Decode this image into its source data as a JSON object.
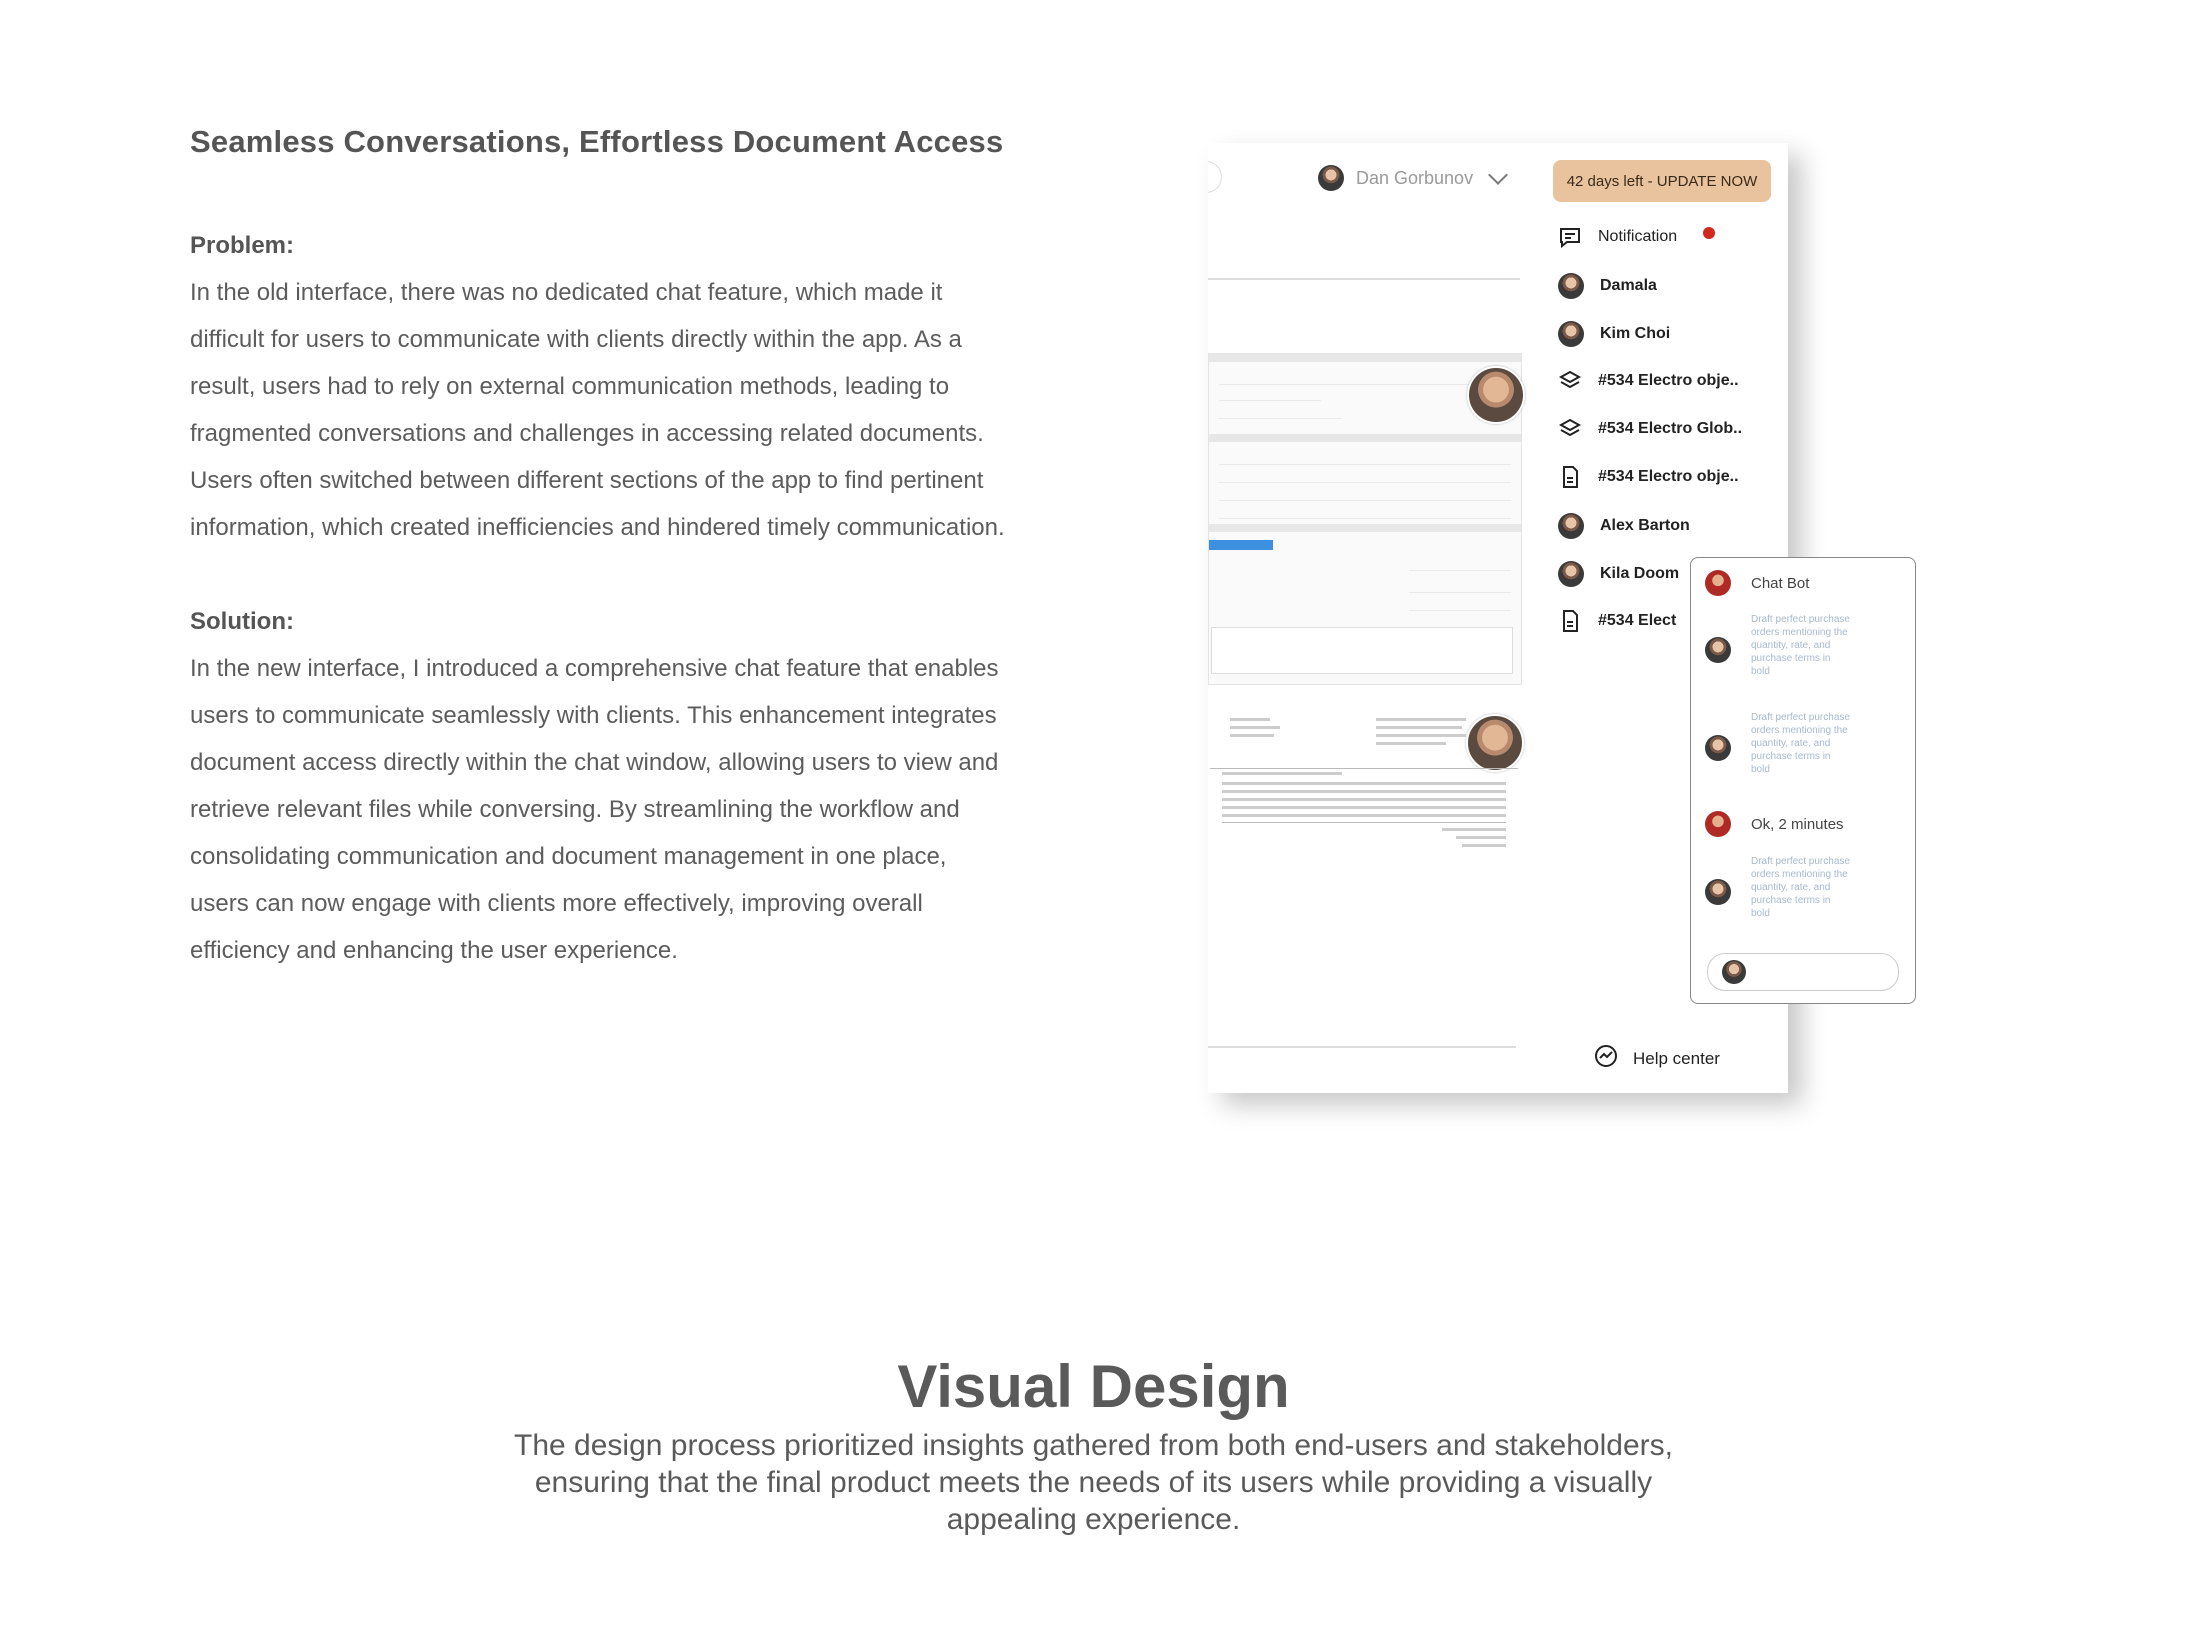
{
  "intro": {
    "heading": "Seamless Conversations, Effortless Document Access",
    "problem_label": "Problem:",
    "problem_text": "In the old interface, there was no dedicated chat feature, which made it difficult for users to communicate with clients directly within the app. As a result, users had to rely on external communication methods, leading to fragmented conversations and challenges in accessing related documents. Users often switched between different sections of the app to find pertinent information, which created inefficiencies and hindered timely communication.",
    "solution_label": "Solution:",
    "solution_text": "In the new interface, I introduced a comprehensive chat feature that enables users to communicate seamlessly with clients. This enhancement integrates document access directly within the chat window, allowing users to view and retrieve relevant files while conversing. By streamlining the workflow and consolidating communication and document management in one place, users can now engage with clients more effectively, improving overall efficiency and enhancing the user experience."
  },
  "mockup": {
    "user_name": "Dan Gorbunov",
    "update_banner": "42 days left - UPDATE NOW",
    "sidebar": [
      {
        "label": "Notification",
        "icon": "chat-bubble-icon"
      },
      {
        "label": "Damala",
        "icon": "avatar"
      },
      {
        "label": "Kim Choi",
        "icon": "avatar"
      },
      {
        "label": "#534 Electro obje..",
        "icon": "layers-icon"
      },
      {
        "label": "#534 Electro Glob..",
        "icon": "layers-icon"
      },
      {
        "label": "#534 Electro obje..",
        "icon": "document-icon"
      },
      {
        "label": "Alex Barton",
        "icon": "avatar"
      },
      {
        "label": "Kila Doom",
        "icon": "avatar"
      },
      {
        "label": "#534 Elect",
        "icon": "document-icon"
      }
    ],
    "help": "Help center",
    "chat": {
      "title": "Chat Bot",
      "messages": [
        "Draft perfect purchase orders mentioning the quantity, rate, and purchase terms in bold",
        "Draft perfect purchase orders mentioning the quantity, rate, and purchase terms in bold",
        "Ok, 2 minutes",
        "Draft perfect purchase orders mentioning the quantity, rate, and purchase terms in bold"
      ]
    },
    "colors": {
      "banner": "#e8c39e",
      "notif_dot": "#d0281e",
      "chat_msg": "#a7b9cf"
    }
  },
  "visual_design": {
    "title": "Visual Design",
    "text": "The design process prioritized insights gathered from both end-users and stakeholders, ensuring that the final product meets the needs of its users while providing a visually appealing experience."
  }
}
